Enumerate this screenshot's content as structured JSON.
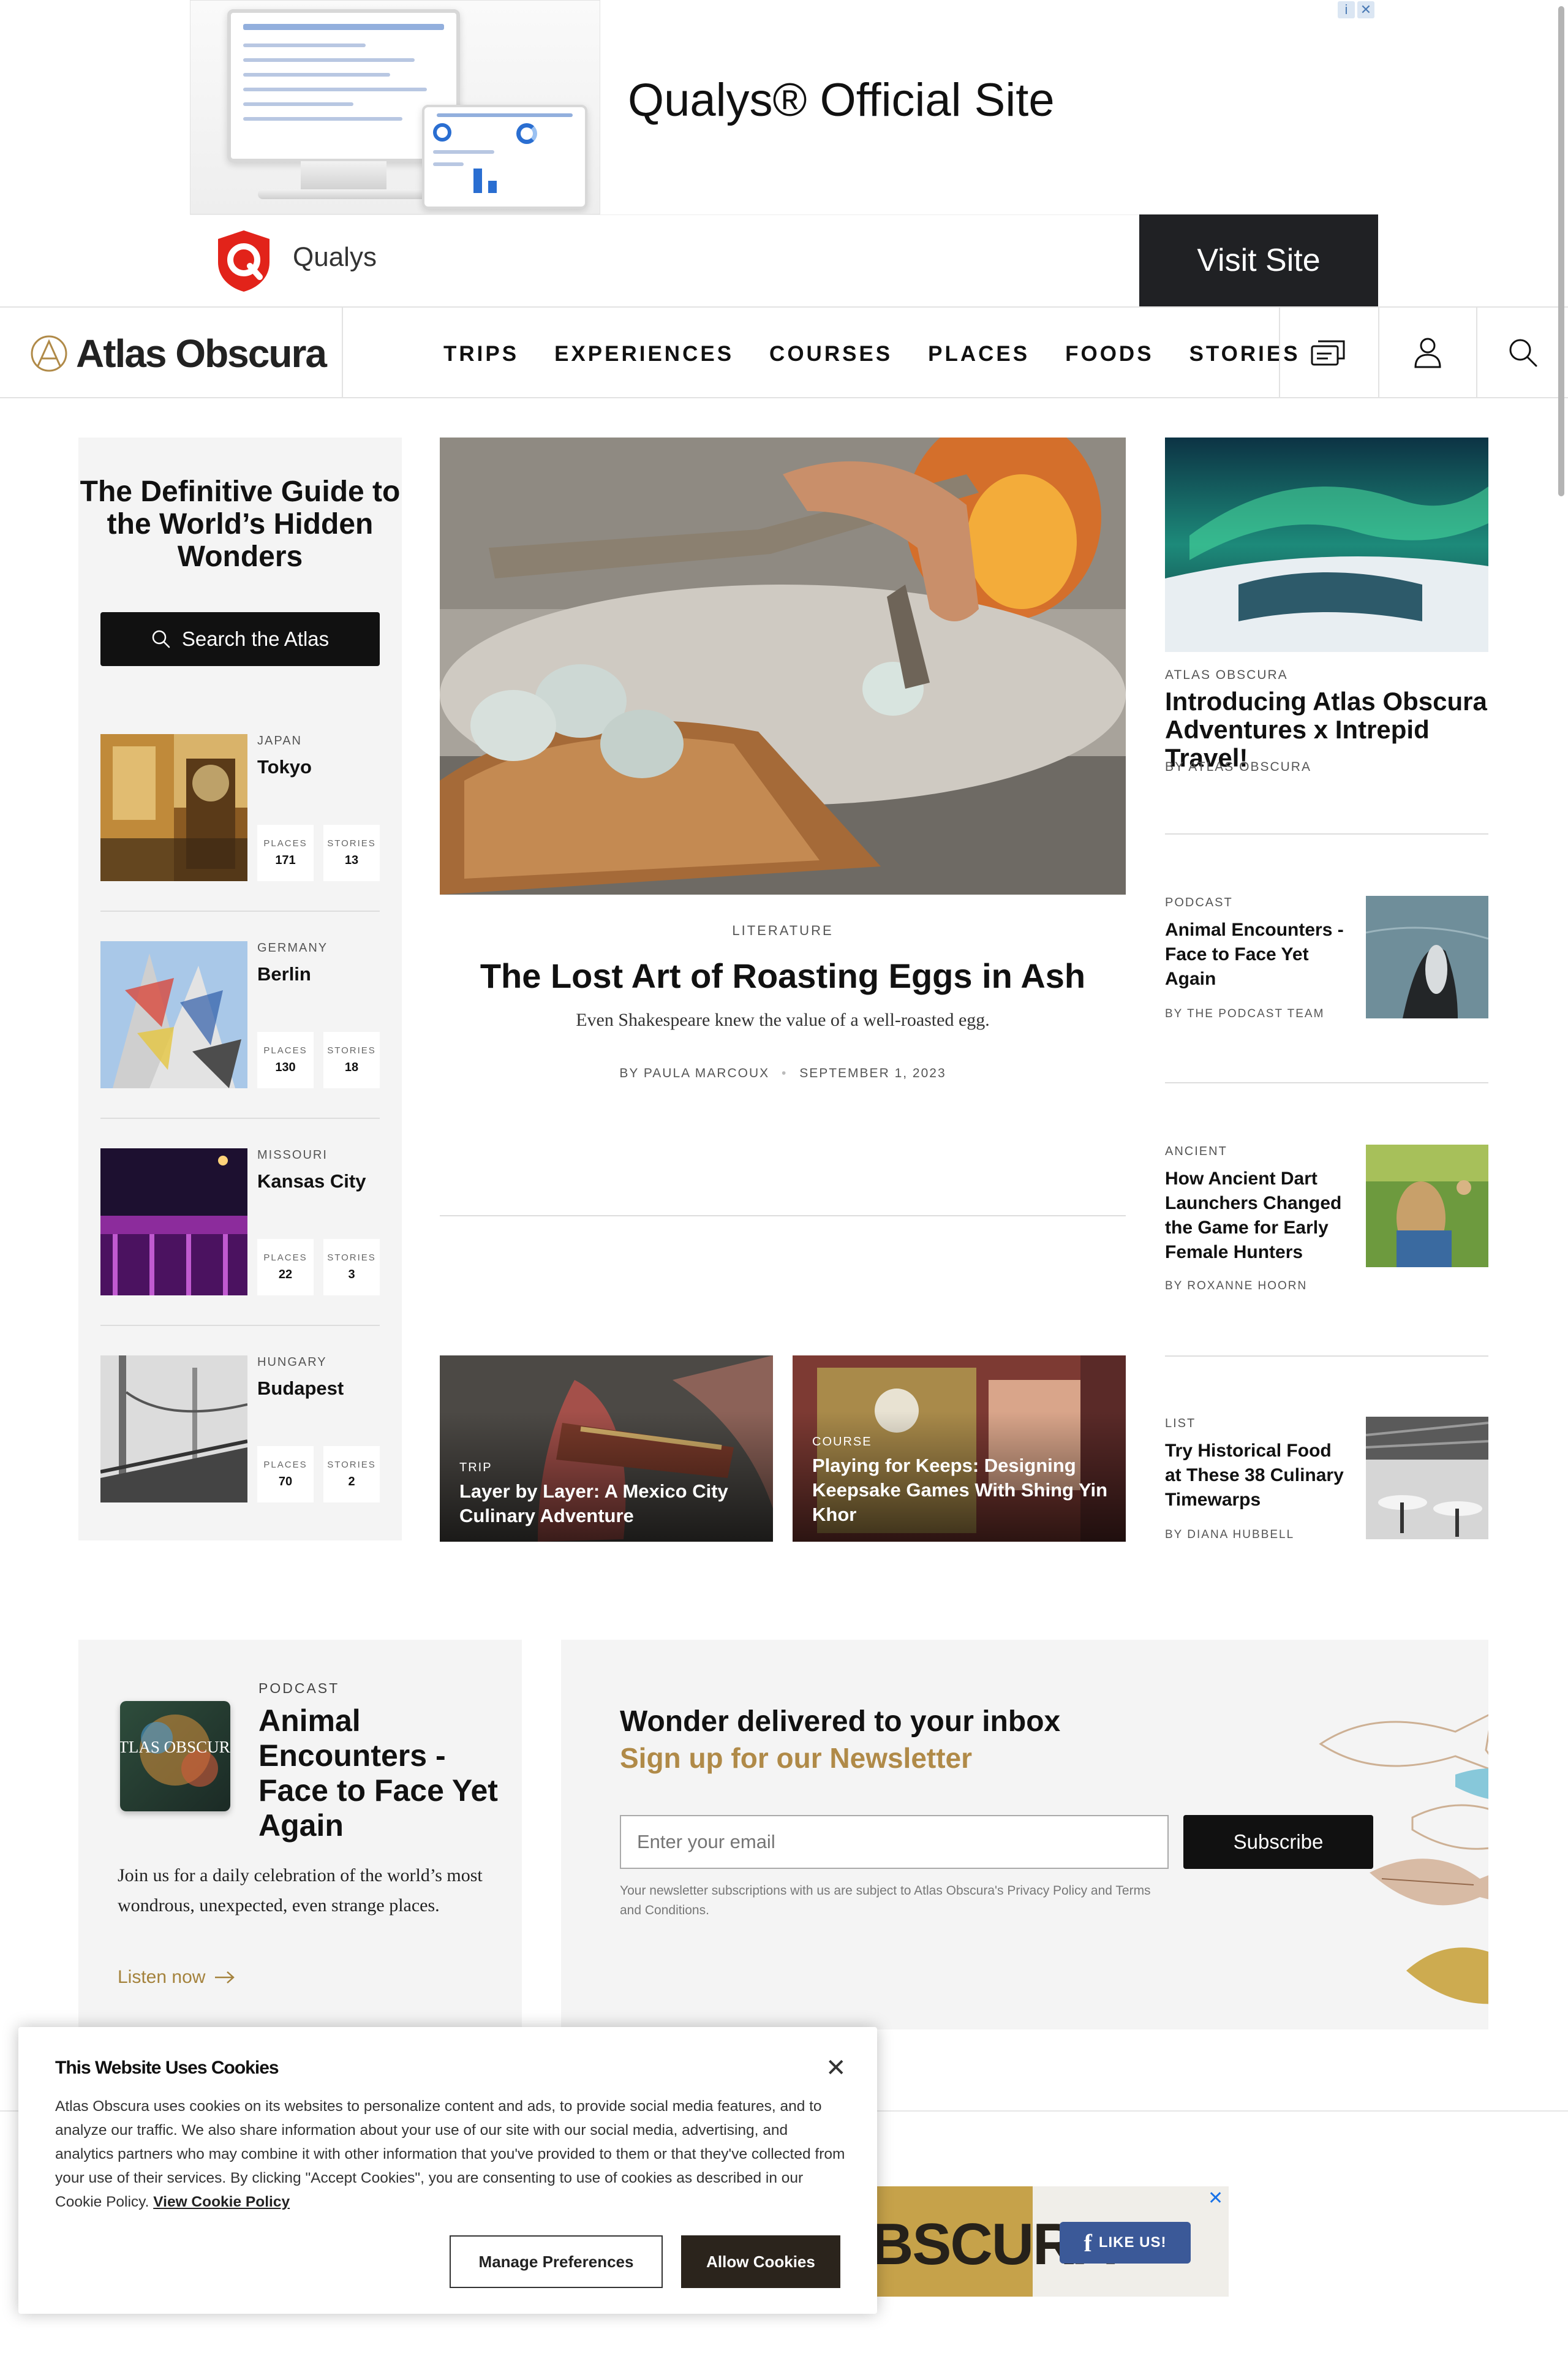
{
  "ad": {
    "headline": "Qualys® Official Site",
    "brand": "Qualys",
    "cta": "Visit Site",
    "choices_icons": [
      "info-icon",
      "close-icon"
    ],
    "brand_color": "#e2231a"
  },
  "nav": {
    "logo": "Atlas Obscura",
    "links": [
      "TRIPS",
      "EXPERIENCES",
      "COURSES",
      "PLACES",
      "FOODS",
      "STORIES"
    ],
    "icons": [
      "trips-ticket-icon",
      "user-icon",
      "search-icon"
    ]
  },
  "sidebar": {
    "title": "The Definitive Guide to the World’s Hidden Wonders",
    "search_label": "Search the Atlas",
    "places_label": "PLACES",
    "stories_label": "STORIES",
    "destinations": [
      {
        "country": "JAPAN",
        "name": "Tokyo",
        "places": "171",
        "stories": "13"
      },
      {
        "country": "GERMANY",
        "name": "Berlin",
        "places": "130",
        "stories": "18"
      },
      {
        "country": "MISSOURI",
        "name": "Kansas City",
        "places": "22",
        "stories": "3"
      },
      {
        "country": "HUNGARY",
        "name": "Budapest",
        "places": "70",
        "stories": "2"
      }
    ]
  },
  "hero": {
    "category": "LITERATURE",
    "title": "The Lost Art of Roasting Eggs in Ash",
    "subtitle": "Even Shakespeare knew the value of a well-roasted egg.",
    "author": "BY PAULA MARCOUX",
    "date": "SEPTEMBER 1, 2023"
  },
  "mini_cards": [
    {
      "category": "TRIP",
      "title": "Layer by Layer: A Mexico City Culinary Adventure"
    },
    {
      "category": "COURSE",
      "title": "Playing for Keeps: Designing Keepsake Games With Shing Yin Khor"
    }
  ],
  "feature": {
    "category": "ATLAS OBSCURA",
    "title": "Introducing Atlas Obscura Adventures x Intrepid Travel!",
    "byline": "BY ATLAS OBSCURA"
  },
  "side_stories": [
    {
      "category": "PODCAST",
      "title": "Animal Encounters - Face to Face Yet Again",
      "byline": "BY THE PODCAST TEAM"
    },
    {
      "category": "ANCIENT",
      "title": "How Ancient Dart Launchers Changed the Game for Early Female Hunters",
      "byline": "BY ROXANNE HOORN"
    },
    {
      "category": "LIST",
      "title": "Try Historical Food at These 38 Culinary Timewarps",
      "byline": "BY DIANA HUBBELL"
    }
  ],
  "podcast": {
    "label": "PODCAST",
    "title": "Animal Encounters - Face to Face Yet Again",
    "description": "Join us for a daily celebration of the world’s most wondrous, unexpected, even strange places.",
    "cta": "Listen now",
    "art_text": "ATLAS OBSCURA"
  },
  "newsletter": {
    "title": "Wonder delivered to your inbox",
    "subtitle": "Sign up for our Newsletter",
    "placeholder": "Enter your email",
    "button": "Subscribe",
    "legal": "Your newsletter subscriptions with us are subject to Atlas Obscura's Privacy Policy and Terms and Conditions."
  },
  "bottom_ad": {
    "text": "BSCURA",
    "like": "LIKE US!",
    "close": "✕"
  },
  "cookie": {
    "title": "This Website Uses Cookies",
    "body": "Atlas Obscura uses cookies on its websites to personalize content and ads, to provide social media features, and to analyze our traffic. We also share information about your use of our site with our social media, advertising, and analytics partners who may combine it with other information that you've provided to them or that they've collected from your use of their services. By clicking \"Accept Cookies\", you are consenting to use of cookies as described in our Cookie Policy.",
    "link": "View Cookie Policy",
    "manage": "Manage Preferences",
    "allow": "Allow Cookies",
    "close": "✕"
  },
  "colors": {
    "accent_gold": "#b08a48",
    "dark": "#111111",
    "panel_bg": "#f4f4f4"
  }
}
